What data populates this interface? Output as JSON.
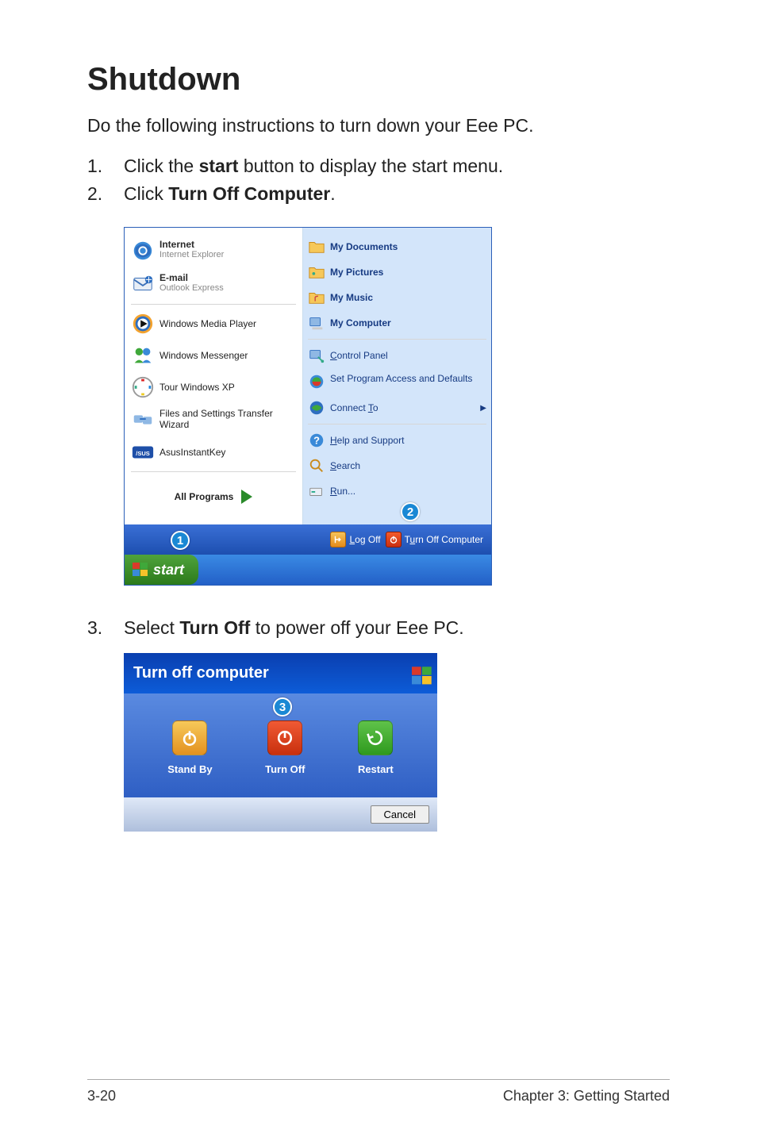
{
  "heading": "Shutdown",
  "intro": "Do the following instructions to turn down your Eee PC.",
  "steps": [
    {
      "num": "1.",
      "pre": "Click the ",
      "bold": "start",
      "post": " button to display the start menu."
    },
    {
      "num": "2.",
      "pre": "Click ",
      "bold": "Turn Off Computer",
      "post": "."
    },
    {
      "num": "3.",
      "pre": "Select ",
      "bold": "Turn Off",
      "post": " to power off your Eee PC."
    }
  ],
  "startmenu": {
    "left": {
      "internet": {
        "title": "Internet",
        "sub": "Internet Explorer"
      },
      "email": {
        "title": "E-mail",
        "sub": "Outlook Express"
      },
      "wmp": "Windows Media Player",
      "msgr": "Windows Messenger",
      "tour": "Tour Windows XP",
      "fst": "Files and Settings Transfer Wizard",
      "asus": "AsusInstantKey",
      "allprograms": "All Programs"
    },
    "right": {
      "mydocs": "My Documents",
      "mypics": "My Pictures",
      "mymusic": "My Music",
      "mycomp": "My Computer",
      "cpanel": "Control Panel",
      "spad": "Set Program Access and Defaults",
      "connect": "Connect To",
      "help": "Help and Support",
      "search": "Search",
      "run": "Run..."
    },
    "footer": {
      "logoff": "Log Off",
      "turnoff": "Turn Off Computer"
    },
    "start": "start"
  },
  "callouts": {
    "one": "1",
    "two": "2",
    "three": "3"
  },
  "dialog": {
    "title": "Turn off computer",
    "standby": "Stand By",
    "turnoff": "Turn Off",
    "restart": "Restart",
    "cancel": "Cancel"
  },
  "footer": {
    "left": "3-20",
    "right": "Chapter 3: Getting Started"
  }
}
